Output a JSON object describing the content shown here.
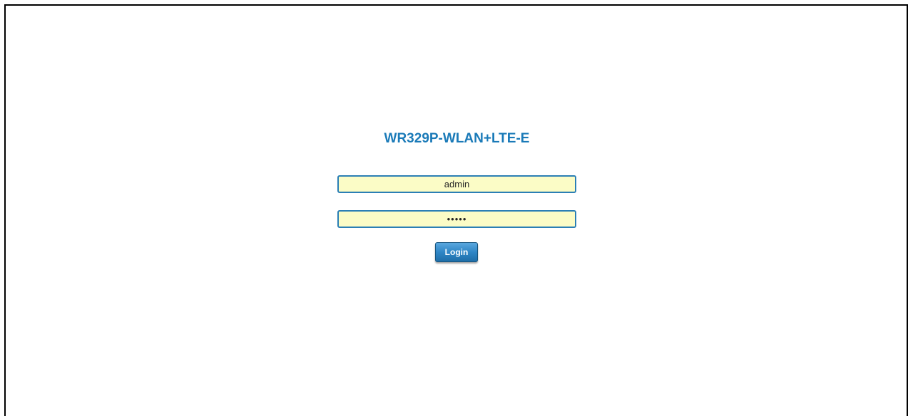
{
  "login": {
    "title": "WR329P-WLAN+LTE-E",
    "username_value": "admin",
    "password_value": "admin",
    "button_label": "Login"
  },
  "colors": {
    "title": "#1a7ab8",
    "field_background": "#fbfcc6",
    "field_border": "#2b7fb5",
    "button": "#2f86c6"
  }
}
